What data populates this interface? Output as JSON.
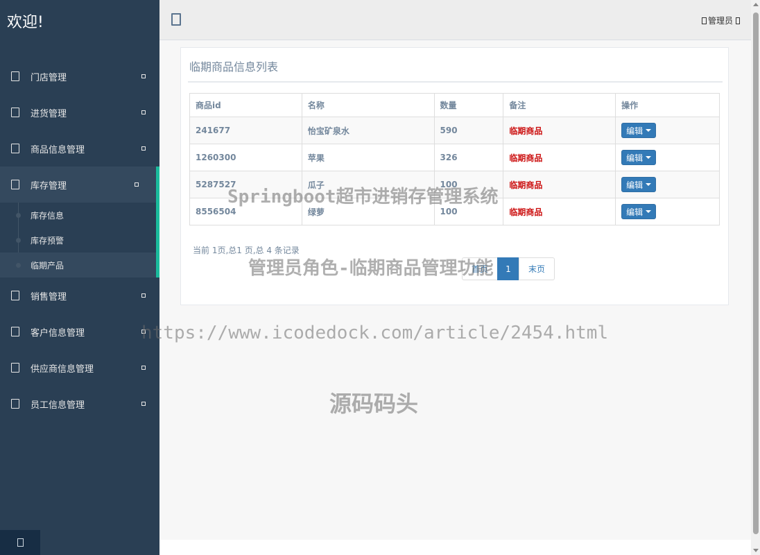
{
  "brand": "欢迎!",
  "sidebar": {
    "items": [
      {
        "label": "门店管理"
      },
      {
        "label": "进货管理"
      },
      {
        "label": "商品信息管理"
      },
      {
        "label": "库存管理"
      },
      {
        "label": "销售管理"
      },
      {
        "label": "客户信息管理"
      },
      {
        "label": "供应商信息管理"
      },
      {
        "label": "员工信息管理"
      }
    ],
    "submenu": [
      {
        "label": "库存信息"
      },
      {
        "label": "库存预警"
      },
      {
        "label": "临期产品"
      }
    ]
  },
  "topnav": {
    "user": "管理员"
  },
  "panel": {
    "title": "临期商品信息列表",
    "columns": [
      "商品id",
      "名称",
      "数量",
      "备注",
      "操作"
    ],
    "rows": [
      {
        "id": "241677",
        "name": "怡宝矿泉水",
        "qty": "590",
        "note": "临期商品",
        "action": "编辑"
      },
      {
        "id": "1260300",
        "name": "苹果",
        "qty": "326",
        "note": "临期商品",
        "action": "编辑"
      },
      {
        "id": "5287527",
        "name": "瓜子",
        "qty": "100",
        "note": "临期商品",
        "action": "编辑"
      },
      {
        "id": "8556504",
        "name": "绿萝",
        "qty": "100",
        "note": "临期商品",
        "action": "编辑"
      }
    ],
    "page_info": "当前 1页,总1 页,总 4 条记录",
    "pagination": {
      "first": "首页",
      "current": "1",
      "last": "末页"
    }
  },
  "watermarks": {
    "w1": "Springboot超市进销存管理系统",
    "w2": "管理员角色-临期商品管理功能",
    "w3": "https://www.icodedock.com/article/2454.html",
    "w4": "源码码头"
  },
  "colors": {
    "sidebar": "#2a3f54",
    "accent": "#1abb9c",
    "primary": "#337ab7",
    "danger": "#cc1111"
  }
}
